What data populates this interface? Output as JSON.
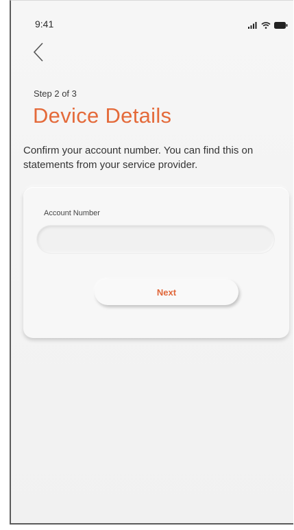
{
  "status_bar": {
    "time": "9:41",
    "icons": [
      "signal-icon",
      "wifi-icon",
      "battery-icon"
    ]
  },
  "nav": {
    "back_icon": "chevron-left-icon"
  },
  "header": {
    "step": "Step 2 of 3",
    "title": "Device Details"
  },
  "instructions": "Confirm your account number. You can find this on statements from your service provider.",
  "form": {
    "account_label": "Account Number",
    "account_value": "",
    "account_placeholder": "",
    "next_label": "Next"
  },
  "colors": {
    "accent": "#e46a3a",
    "background": "#f4f4f4",
    "text": "#333333"
  }
}
